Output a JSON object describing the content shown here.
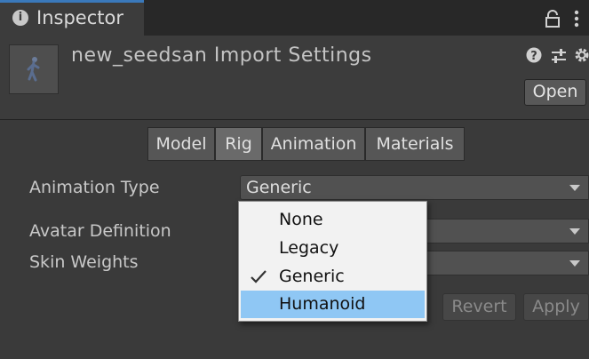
{
  "window": {
    "tab_title": "Inspector",
    "tab_icon": "info-icon",
    "tab_icon_glyph": "i"
  },
  "header": {
    "title": "new_seedsan Import Settings",
    "open_label": "Open"
  },
  "tabs": [
    {
      "label": "Model",
      "active": false
    },
    {
      "label": "Rig",
      "active": true
    },
    {
      "label": "Animation",
      "active": false
    },
    {
      "label": "Materials",
      "active": false
    }
  ],
  "fields": {
    "animation_type": {
      "label": "Animation Type",
      "value": "Generic"
    },
    "avatar_definition": {
      "label": "Avatar Definition",
      "value": ""
    },
    "skin_weights": {
      "label": "Skin Weights",
      "value": ""
    }
  },
  "dropdown_menu": {
    "options": [
      {
        "label": "None",
        "checked": false,
        "highlighted": false
      },
      {
        "label": "Legacy",
        "checked": false,
        "highlighted": false
      },
      {
        "label": "Generic",
        "checked": true,
        "highlighted": false
      },
      {
        "label": "Humanoid",
        "checked": false,
        "highlighted": true
      }
    ]
  },
  "footer": {
    "revert_label": "Revert",
    "apply_label": "Apply"
  },
  "colors": {
    "accent": "#3a79bb",
    "highlight": "#8fc7f4",
    "background": "#3a3a3a"
  }
}
